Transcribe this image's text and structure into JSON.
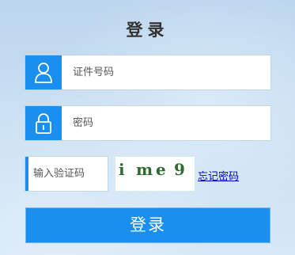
{
  "login": {
    "title": "登录",
    "id_field": {
      "placeholder": "证件号码",
      "icon": "user-icon"
    },
    "password_field": {
      "placeholder": "密码",
      "icon": "lock-icon"
    },
    "captcha": {
      "placeholder": "输入验证码",
      "chars": [
        "i",
        "m",
        "e",
        "9"
      ]
    },
    "forgot_link": "忘记密码",
    "submit_label": "登录"
  },
  "colors": {
    "accent": "#1a8ff0",
    "captcha_text": "#2e6a2e",
    "link": "#0000cc"
  }
}
